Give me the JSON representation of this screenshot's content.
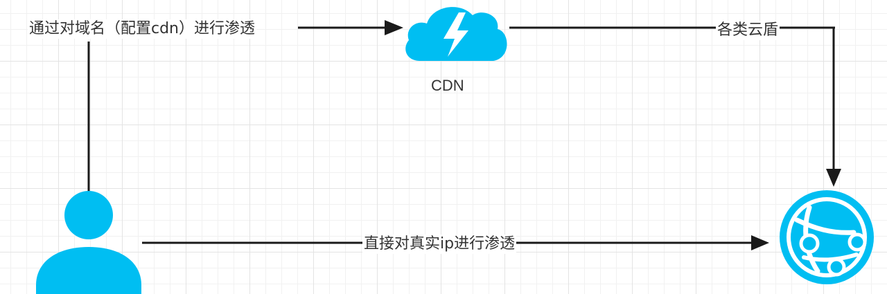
{
  "diagram": {
    "nodes": {
      "cdn": {
        "label": "CDN",
        "icon": "lightning-cloud-icon"
      },
      "attacker": {
        "icon": "user-icon"
      },
      "server": {
        "icon": "web-globe-icon"
      }
    },
    "edges": {
      "via_domain": {
        "label": "通过对域名（配置cdn）进行渗透"
      },
      "cloud_shield": {
        "label": "各类云盾"
      },
      "direct_ip": {
        "label": "直接对真实ip进行渗透"
      }
    },
    "colors": {
      "accent": "#00bef2",
      "line": "#1a1a1a",
      "bolt": "#ffffff"
    }
  }
}
